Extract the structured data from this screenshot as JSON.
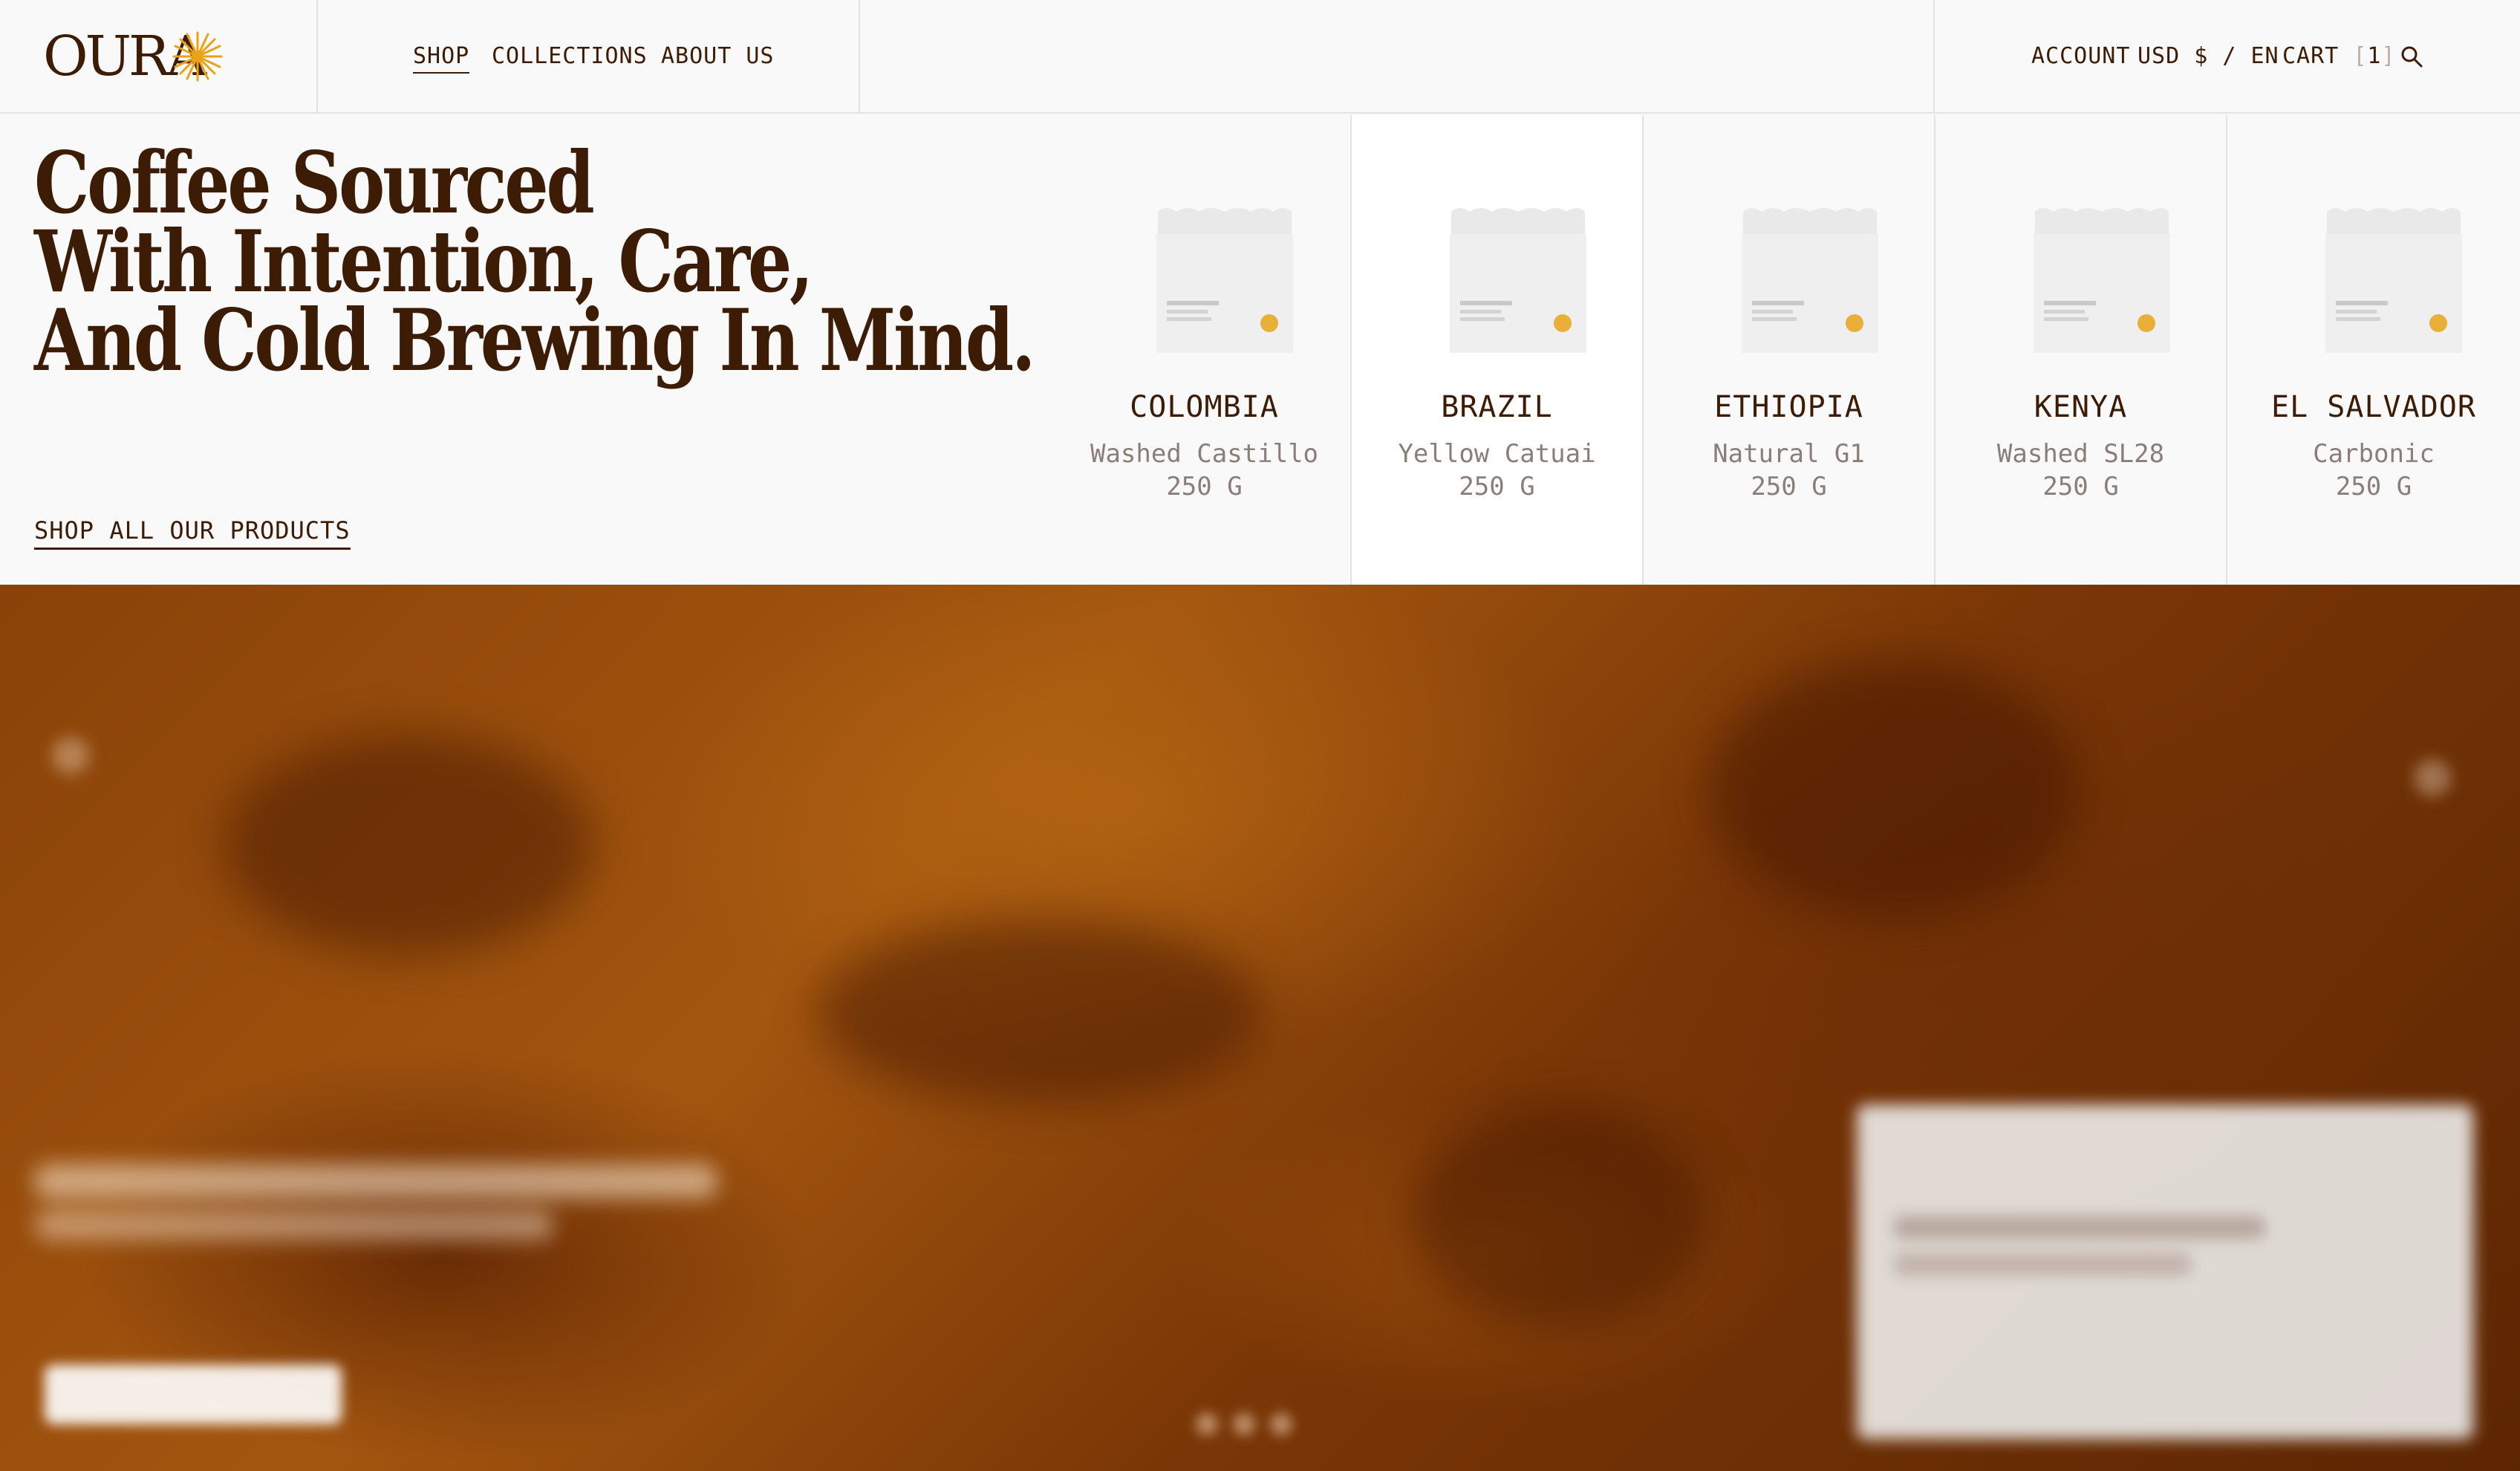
{
  "brand": {
    "logo_text": "OURA",
    "accent_color": "#e8a317",
    "text_color": "#3d1c06"
  },
  "nav": {
    "items": [
      {
        "label": "SHOP",
        "active": true
      },
      {
        "label": "COLLECTIONS",
        "active": false
      },
      {
        "label": "ABOUT US",
        "active": false
      }
    ]
  },
  "utility": {
    "account": "ACCOUNT",
    "currency_lang": "USD $ / EN",
    "cart_label": "CART",
    "cart_open": "[",
    "cart_count": "1",
    "cart_close": "]",
    "search_icon": "search-icon"
  },
  "hero": {
    "headline_lines": [
      "Coffee Sourced",
      "With Intention, Care,",
      "And Cold Brewing In Mind."
    ],
    "cta": "SHOP ALL OUR PRODUCTS"
  },
  "products": [
    {
      "name": "COLOMBIA",
      "variant": "Washed Castillo",
      "weight": "250 G"
    },
    {
      "name": "BRAZIL",
      "variant": "Yellow Catuai",
      "weight": "250 G"
    },
    {
      "name": "ETHIOPIA",
      "variant": "Natural G1",
      "weight": "250 G"
    },
    {
      "name": "KENYA",
      "variant": "Washed SL28",
      "weight": "250 G"
    },
    {
      "name": "EL SALVADOR",
      "variant": "Carbonic",
      "weight": "250 G"
    }
  ]
}
